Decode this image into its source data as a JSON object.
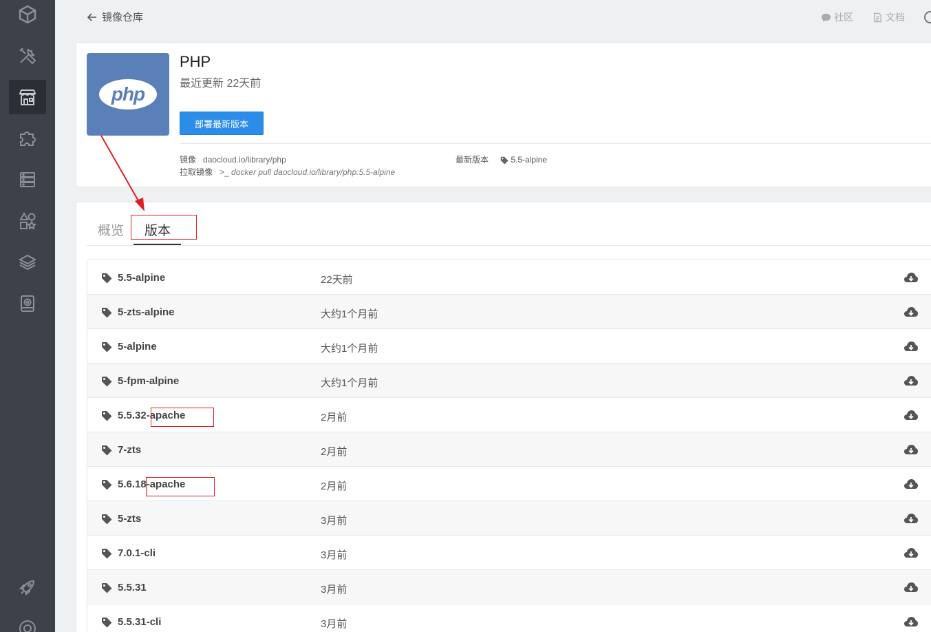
{
  "topbar": {
    "back_label": "镜像仓库",
    "community_label": "社区",
    "docs_label": "文档"
  },
  "sidebar": {
    "items": [
      {
        "icon": "cube-logo-icon"
      },
      {
        "icon": "tools-icon"
      },
      {
        "icon": "store-icon",
        "active": true
      },
      {
        "icon": "puzzle-icon"
      },
      {
        "icon": "server-icon"
      },
      {
        "icon": "shapes-icon"
      },
      {
        "icon": "layers-icon"
      },
      {
        "icon": "camera-icon"
      },
      {
        "icon": "rocket-icon"
      },
      {
        "icon": "help-icon"
      }
    ]
  },
  "image": {
    "logo_text": "php",
    "title": "PHP",
    "updated": "最近更新 22天前",
    "deploy_label": "部署最新版本",
    "image_label": "镜像",
    "image_value": "daocloud.io/library/php",
    "pull_label": "拉取镜像",
    "pull_prompt": ">_",
    "pull_value": "docker pull daocloud.io/library/php:5.5-alpine",
    "latest_label": "最新版本",
    "latest_value": "5.5-alpine"
  },
  "tabs": {
    "overview": "概览",
    "versions": "版本"
  },
  "versions": [
    {
      "name": "5.5-alpine",
      "time": "22天前"
    },
    {
      "name": "5-zts-alpine",
      "time": "大约1个月前"
    },
    {
      "name": "5-alpine",
      "time": "大约1个月前"
    },
    {
      "name": "5-fpm-alpine",
      "time": "大约1个月前"
    },
    {
      "name": "5.5.32-apache",
      "time": "2月前"
    },
    {
      "name": "7-zts",
      "time": "2月前"
    },
    {
      "name": "5.6.18-apache",
      "time": "2月前"
    },
    {
      "name": "5-zts",
      "time": "3月前"
    },
    {
      "name": "7.0.1-cli",
      "time": "3月前"
    },
    {
      "name": "5.5.31",
      "time": "3月前"
    },
    {
      "name": "5.5.31-cli",
      "time": "3月前"
    }
  ],
  "colors": {
    "sidebar_bg": "#3d4149",
    "primary": "#2b8de8",
    "php_blue": "#5b7fb9",
    "annotation": "#e02020"
  }
}
